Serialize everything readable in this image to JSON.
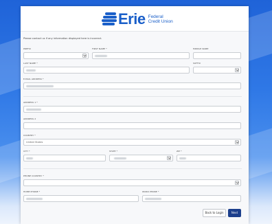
{
  "header": {
    "logo_word": "Erie",
    "logo_sub_line1": "Federal",
    "logo_sub_line2": "Credit Union"
  },
  "form": {
    "notice": "Please contact us if any information displayed here is incorrect.",
    "fields": {
      "prefix": "PREFIX",
      "first_name": "FIRST NAME *",
      "middle_name": "MIDDLE NAME",
      "last_name": "LAST NAME *",
      "suffix": "SUFFIX",
      "email": "E-MAIL ADDRESS *",
      "address1": "ADDRESS 1 *",
      "address2": "ADDRESS 2",
      "country": "COUNTRY *",
      "country_value": "United States",
      "city": "CITY *",
      "state": "STATE *",
      "zip": "ZIP *",
      "phone_country": "PHONE COUNTRY *",
      "home_phone": "HOME PHONE *",
      "work_phone": "WORK PHONE *"
    }
  },
  "buttons": {
    "back": "Back to Login",
    "next": "Next"
  },
  "colors": {
    "brand": "#1a5fc9",
    "primary_button": "#1c3f8c"
  }
}
